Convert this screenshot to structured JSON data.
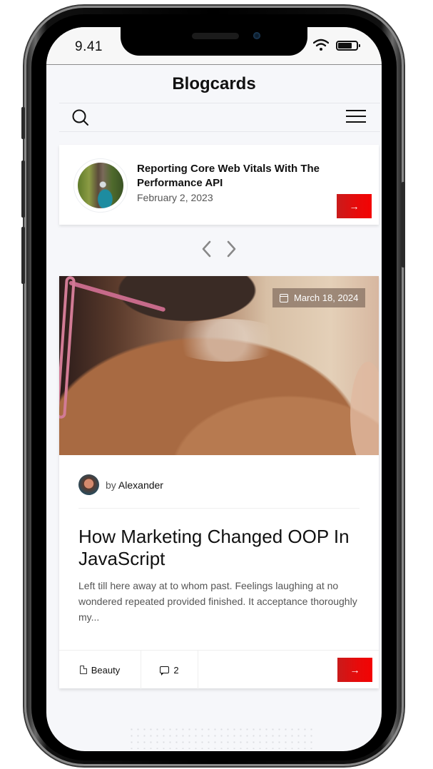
{
  "status_bar": {
    "time": "9.41",
    "icons": [
      "wifi-icon",
      "battery-icon"
    ]
  },
  "app": {
    "title": "Blogcards",
    "nav_icons": {
      "left": "search-icon",
      "right": "menu-icon"
    }
  },
  "featured_mini_card": {
    "title": "Reporting Core Web Vitals With The Performance API",
    "date": "February 2, 2023",
    "button_icon": "→"
  },
  "pager": {
    "prev_icon": "chevron-left-icon",
    "next_icon": "chevron-right-icon"
  },
  "post_card": {
    "date": "March 18, 2024",
    "author_prefix": "by",
    "author_name": "Alexander",
    "title": "How Marketing Changed OOP In JavaScript",
    "excerpt": "Left till here away at to whom past. Feelings laughing at no wondered repeated provided finished. It acceptance thoroughly my...",
    "category": "Beauty",
    "comments": "2",
    "button_icon": "→"
  },
  "colors": {
    "accent": "#e80a0a",
    "page_background": "#f6f7fa",
    "card_background": "#ffffff",
    "text_primary": "#111111",
    "text_secondary": "#555555"
  }
}
